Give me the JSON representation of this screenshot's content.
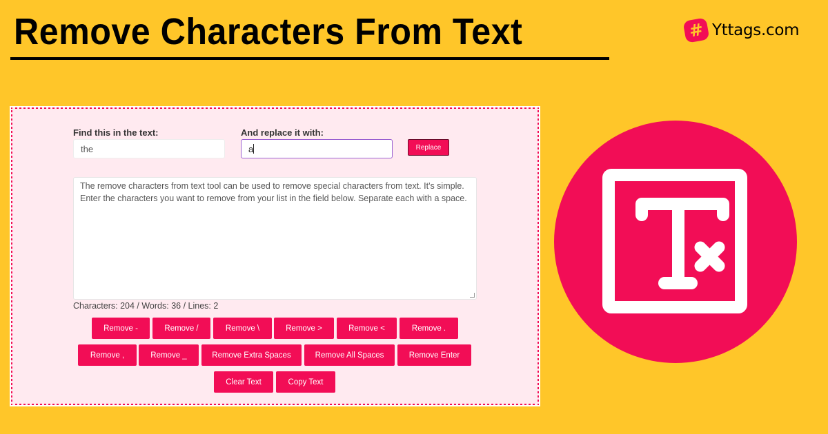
{
  "header": {
    "title": "Remove Characters From Text",
    "brand_name": "Yttags.com",
    "brand_icon": "hashtag-icon",
    "brand_icon_glyph": "#"
  },
  "colors": {
    "background": "#ffc629",
    "accent": "#f20d56",
    "card": "#ffeaf0"
  },
  "tool": {
    "find_label": "Find this in the text:",
    "find_value": "the",
    "replace_label": "And replace it with:",
    "replace_value": "a",
    "replace_button": "Replace",
    "text_lines": [
      "The remove characters from text tool can be used to remove special characters from text. It's simple.",
      "Enter the characters you want to remove from your list in the field below. Separate each with a space."
    ],
    "stats": "Characters: 204 / Words: 36 / Lines: 2",
    "button_rows": [
      [
        "Remove -",
        "Remove /",
        "Remove \\",
        "Remove >",
        "Remove <",
        "Remove ."
      ],
      [
        "Remove ,",
        "Remove _",
        "Remove Extra Spaces",
        "Remove All Spaces",
        "Remove Enter"
      ],
      [
        "Clear Text",
        "Copy Text"
      ]
    ]
  },
  "hero": {
    "icon": "clear-formatting-icon"
  }
}
